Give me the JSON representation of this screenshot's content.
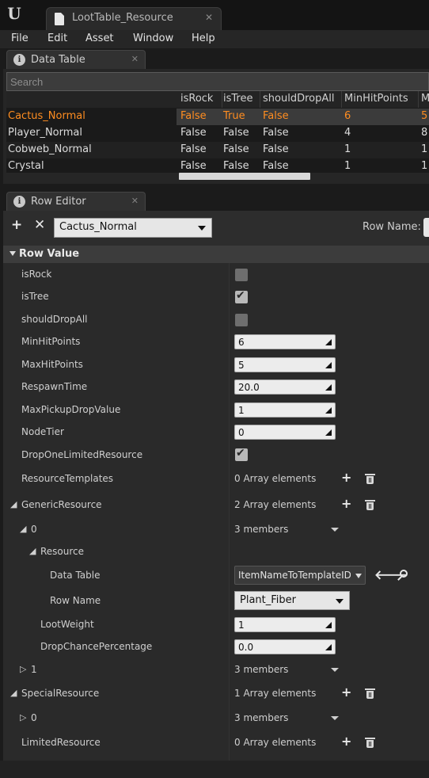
{
  "title_bar": {
    "logo": "U",
    "document_tab": "LootTable_Resource",
    "close": "✕"
  },
  "menu": [
    "File",
    "Edit",
    "Asset",
    "Window",
    "Help"
  ],
  "data_table_panel": {
    "tab_label": "Data Table",
    "search_placeholder": "Search",
    "columns": [
      "isRock",
      "isTree",
      "shouldDropAll",
      "MinHitPoints",
      "M"
    ],
    "rows": [
      {
        "name": "Cactus_Normal",
        "values": [
          "False",
          "True",
          "False",
          "6",
          "5"
        ],
        "selected": true
      },
      {
        "name": "Player_Normal",
        "values": [
          "False",
          "False",
          "False",
          "4",
          "8"
        ]
      },
      {
        "name": "Cobweb_Normal",
        "values": [
          "False",
          "False",
          "False",
          "1",
          "1"
        ]
      },
      {
        "name": "Crystal",
        "values": [
          "False",
          "False",
          "False",
          "1",
          "1"
        ]
      }
    ],
    "horizontal_scroll_fraction": 0.52
  },
  "row_editor": {
    "tab_label": "Row Editor",
    "add": "+",
    "remove": "✕",
    "selected_row": "Cactus_Normal",
    "row_name_label": "Row Name:",
    "section_title": "Row Value",
    "props": {
      "isRock": {
        "label": "isRock",
        "checked": false
      },
      "isTree": {
        "label": "isTree",
        "checked": true
      },
      "shouldDropAll": {
        "label": "shouldDropAll",
        "checked": false
      },
      "MinHitPoints": {
        "label": "MinHitPoints",
        "value": "6"
      },
      "MaxHitPoints": {
        "label": "MaxHitPoints",
        "value": "5"
      },
      "RespawnTime": {
        "label": "RespawnTime",
        "value": "20.0"
      },
      "MaxPickupDropValue": {
        "label": "MaxPickupDropValue",
        "value": "1"
      },
      "NodeTier": {
        "label": "NodeTier",
        "value": "0"
      },
      "DropOneLimitedResource": {
        "label": "DropOneLimitedResource",
        "checked": true
      },
      "ResourceTemplates": {
        "label": "ResourceTemplates",
        "value": "0 Array elements"
      },
      "GenericResource": {
        "label": "GenericResource",
        "value": "2 Array elements"
      },
      "GenericResource_0": {
        "label": "0",
        "value": "3 members"
      },
      "Resource": {
        "label": "Resource"
      },
      "DataTable": {
        "label": "Data Table",
        "value": "ItemNameToTemplateID"
      },
      "RowName": {
        "label": "Row Name",
        "value": "Plant_Fiber"
      },
      "LootWeight": {
        "label": "LootWeight",
        "value": "1"
      },
      "DropChancePercentage": {
        "label": "DropChancePercentage",
        "value": "0.0"
      },
      "GenericResource_1": {
        "label": "1",
        "value": "3 members"
      },
      "SpecialResource": {
        "label": "SpecialResource",
        "value": "1 Array elements"
      },
      "SpecialResource_0": {
        "label": "0",
        "value": "3 members"
      },
      "LimitedResource": {
        "label": "LimitedResource",
        "value": "0 Array elements"
      }
    }
  },
  "colors": {
    "selected_text": "#ff8d20",
    "background": "#1b1b1b",
    "panel": "#2a2a2a"
  },
  "icons": [
    "unreal-logo-icon",
    "document-icon",
    "info-icon",
    "plus-icon",
    "x-icon",
    "trash-icon",
    "back-arrow-icon",
    "magnifier-icon",
    "chevron-down-icon"
  ]
}
